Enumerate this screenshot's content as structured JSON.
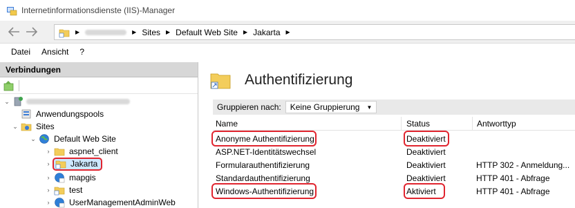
{
  "window": {
    "title": "Internetinformationsdienste (IIS)-Manager"
  },
  "address": {
    "segments": [
      "Sites",
      "Default Web Site",
      "Jakarta"
    ]
  },
  "menu": [
    "Datei",
    "Ansicht",
    "?"
  ],
  "connections": {
    "title": "Verbindungen",
    "tree": [
      {
        "label": "Anwendungspools"
      },
      {
        "label": "Sites"
      },
      {
        "label": "Default Web Site"
      },
      {
        "label": "aspnet_client"
      },
      {
        "label": "Jakarta"
      },
      {
        "label": "mapgis"
      },
      {
        "label": "test"
      },
      {
        "label": "UserManagementAdminWeb"
      }
    ]
  },
  "main": {
    "title": "Authentifizierung",
    "group_label": "Gruppieren nach:",
    "group_value": "Keine Gruppierung",
    "columns": [
      "Name",
      "Status",
      "Antworttyp"
    ],
    "rows": [
      {
        "name": "Anonyme Authentifizierung",
        "status": "Deaktiviert",
        "response": ""
      },
      {
        "name": "ASP.NET-Identitätswechsel",
        "status": "Deaktiviert",
        "response": ""
      },
      {
        "name": "Formularauthentifizierung",
        "status": "Deaktiviert",
        "response": "HTTP 302 - Anmeldung..."
      },
      {
        "name": "Standardauthentifizierung",
        "status": "Deaktiviert",
        "response": "HTTP 401 - Abfrage"
      },
      {
        "name": "Windows-Authentifizierung",
        "status": "Aktiviert",
        "response": "HTTP 401 - Abfrage"
      }
    ]
  },
  "colors": {
    "highlight": "#e0242e",
    "selection": "#cde8ff",
    "header_bg": "#d7d7d7"
  }
}
